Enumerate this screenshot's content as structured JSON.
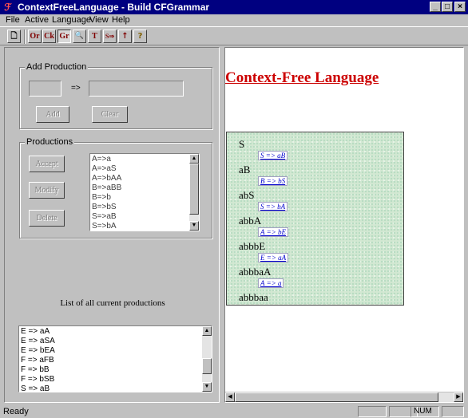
{
  "window": {
    "title": "ContextFreeLanguage - Build CFGrammar",
    "minimize_glyph": "_",
    "maximize_glyph": "□",
    "close_glyph": "×"
  },
  "menu": [
    "File",
    "Active",
    "Language",
    "View",
    "Help"
  ],
  "toolbar": {
    "buttons": [
      {
        "name": "new-icon",
        "glyph": "🗋"
      },
      {
        "name": "or",
        "glyph": "Or"
      },
      {
        "name": "ck",
        "glyph": "Ck"
      },
      {
        "name": "gr",
        "glyph": "Gr"
      },
      {
        "name": "search-icon",
        "glyph": "🔍"
      },
      {
        "name": "tree-icon",
        "glyph": "T"
      },
      {
        "name": "s-arrow-icon",
        "glyph": "S⇒"
      },
      {
        "name": "step-icon",
        "glyph": "↑"
      },
      {
        "name": "help-icon",
        "glyph": "?"
      }
    ]
  },
  "add_production": {
    "label": "Add Production",
    "lhs_value": "",
    "arrow": "=>",
    "rhs_value": "",
    "add_label": "Add",
    "clear_label": "Clear"
  },
  "productions": {
    "label": "Productions",
    "accept_label": "Accept",
    "modify_label": "Modify",
    "delete_label": "Delete",
    "items": [
      "A=>a",
      "A=>aS",
      "A=>bAA",
      "B=>aBB",
      "B=>b",
      "B=>bS",
      "S=>aB",
      "S=>bA"
    ]
  },
  "current_list": {
    "label": "List of all current productions",
    "items": [
      "E => aA",
      "E => aSA",
      "E => bEA",
      "F => aFB",
      "F => bB",
      "F => bSB",
      "S => aB"
    ]
  },
  "derivation": {
    "heading": "Context-Free Language",
    "steps": [
      {
        "form": "S",
        "rule": "S => aB"
      },
      {
        "form": "aB",
        "rule": "B => bS"
      },
      {
        "form": "abS",
        "rule": "S => bA"
      },
      {
        "form": "abbA",
        "rule": "A => bE"
      },
      {
        "form": "abbbE",
        "rule": "E => aA"
      },
      {
        "form": "abbbaA",
        "rule": "A => a"
      },
      {
        "form": "abbbaa",
        "rule": ""
      }
    ]
  },
  "status": {
    "text": "Ready",
    "num": "NUM"
  }
}
